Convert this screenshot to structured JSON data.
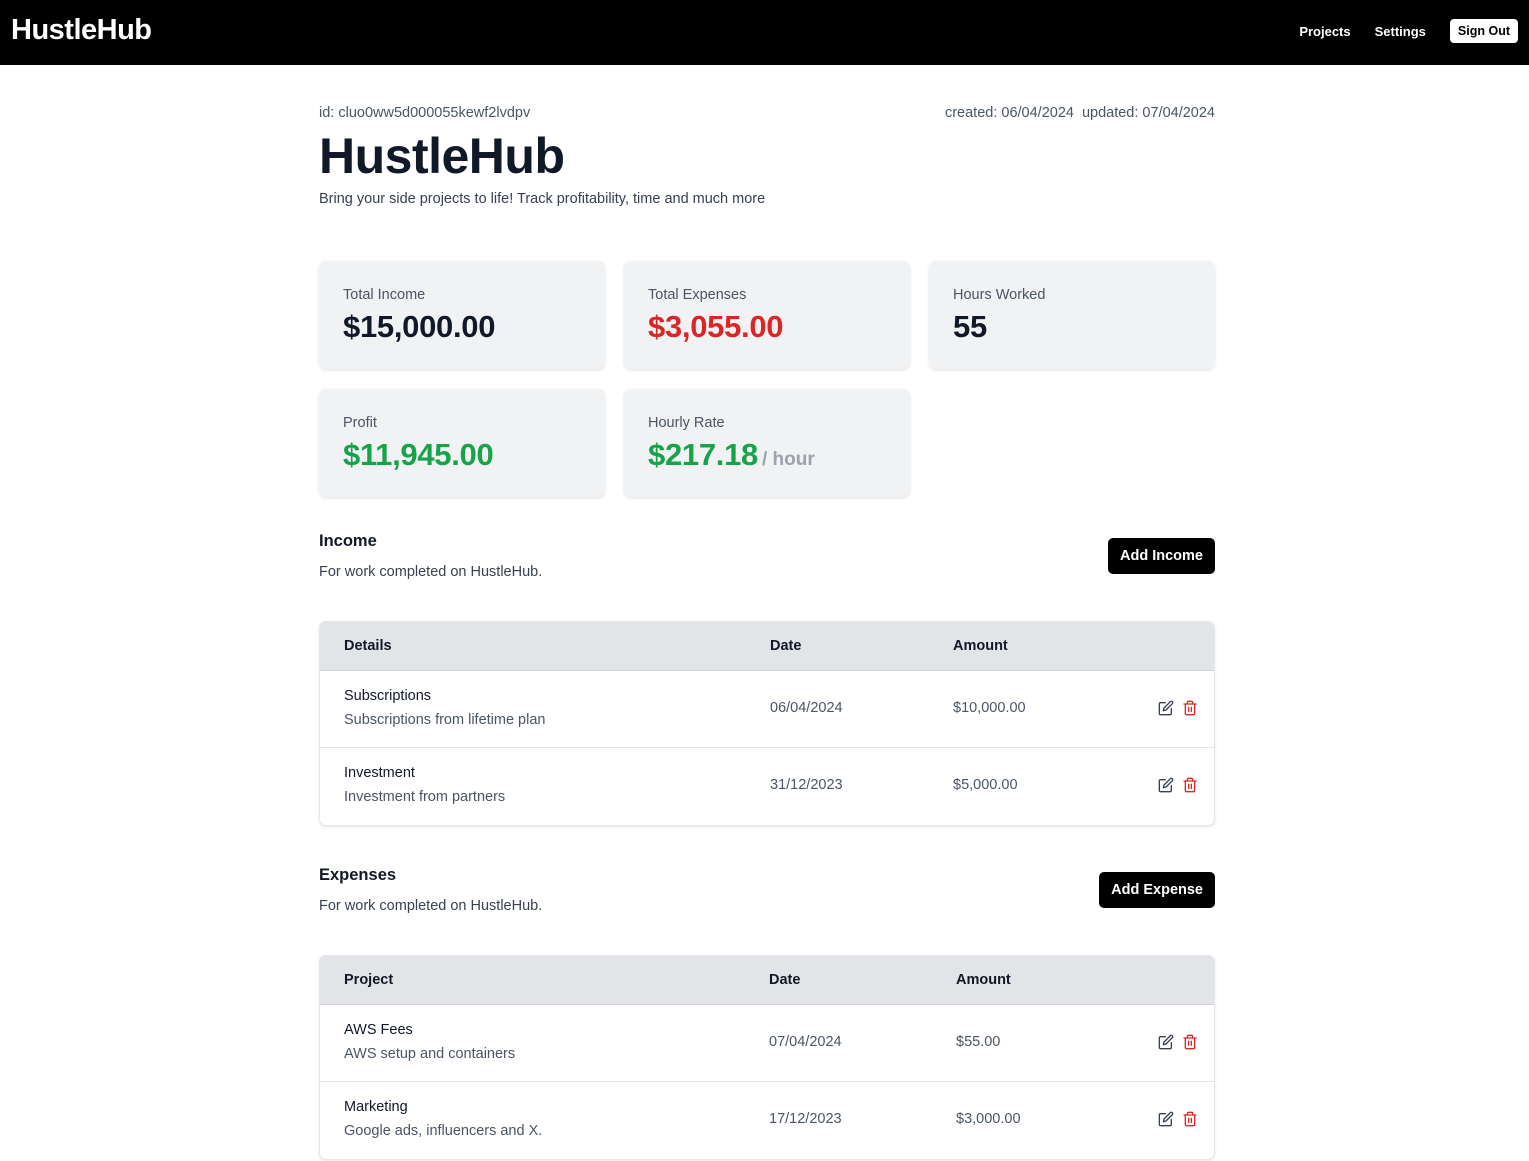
{
  "nav": {
    "logo": "HustleHub",
    "links": [
      "Projects",
      "Settings"
    ],
    "signout_label": "Sign Out"
  },
  "project": {
    "id_label": "id: cluo0ww5d000055kewf2lvdpv",
    "created_label": "created: 06/04/2024",
    "updated_label": "updated: 07/04/2024",
    "title": "HustleHub",
    "description": "Bring your side projects to life! Track profitability, time and much more"
  },
  "stats": {
    "total_income": {
      "label": "Total Income",
      "value": "$15,000.00"
    },
    "total_expenses": {
      "label": "Total Expenses",
      "value": "$3,055.00"
    },
    "hours_worked": {
      "label": "Hours Worked",
      "value": "55"
    },
    "profit": {
      "label": "Profit",
      "value": "$11,945.00"
    },
    "hourly_rate": {
      "label": "Hourly Rate",
      "value": "$217.18",
      "unit": "/ hour"
    }
  },
  "income": {
    "title": "Income",
    "description": "For work completed on HustleHub.",
    "add_label": "Add Income",
    "columns": [
      "Details",
      "Date",
      "Amount"
    ],
    "rows": [
      {
        "title": "Subscriptions",
        "subtitle": "Subscriptions from lifetime plan",
        "date": "06/04/2024",
        "amount": "$10,000.00"
      },
      {
        "title": "Investment",
        "subtitle": "Investment from partners",
        "date": "31/12/2023",
        "amount": "$5,000.00"
      }
    ]
  },
  "expenses": {
    "title": "Expenses",
    "description": "For work completed on HustleHub.",
    "add_label": "Add Expense",
    "columns": [
      "Project",
      "Date",
      "Amount"
    ],
    "rows": [
      {
        "title": "AWS Fees",
        "subtitle": "AWS setup and containers",
        "date": "07/04/2024",
        "amount": "$55.00"
      },
      {
        "title": "Marketing",
        "subtitle": "Google ads, influencers and X.",
        "date": "17/12/2023",
        "amount": "$3,000.00"
      }
    ]
  },
  "icons": {
    "edit": "pencil-square-icon",
    "delete": "trash-icon"
  },
  "colors": {
    "negative": "#dc2626",
    "positive": "#16a34a",
    "nav_bg": "#000000"
  }
}
